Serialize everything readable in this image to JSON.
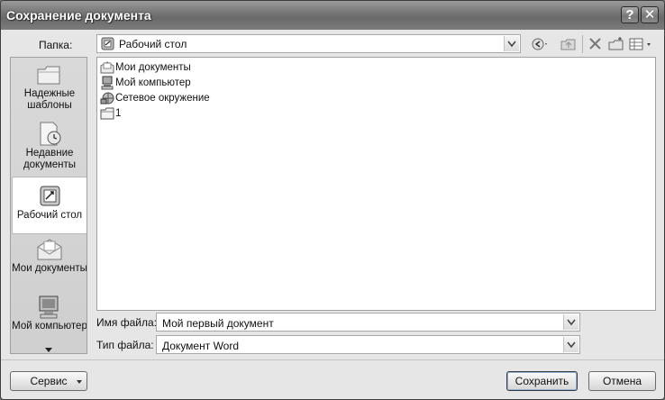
{
  "window": {
    "title": "Сохранение документа",
    "help_button": "?",
    "close_button": "✕"
  },
  "location": {
    "label": "Папка:",
    "value": "Рабочий стол"
  },
  "places": [
    {
      "label": "Надежные шаблоны",
      "icon": "folder-icon"
    },
    {
      "label": "Недавние документы",
      "icon": "recent-documents-icon"
    },
    {
      "label": "Рабочий стол",
      "icon": "desktop-icon",
      "selected": true
    },
    {
      "label": "Мои документы",
      "icon": "my-documents-icon"
    },
    {
      "label": "Мой компьютер",
      "icon": "my-computer-icon"
    }
  ],
  "files": [
    {
      "name": "Мои документы",
      "icon": "my-documents-icon"
    },
    {
      "name": "Мой компьютер",
      "icon": "my-computer-icon"
    },
    {
      "name": "Сетевое окружение",
      "icon": "network-icon"
    },
    {
      "name": "1",
      "icon": "folder-icon"
    }
  ],
  "filename": {
    "label": "Имя файла:",
    "value": "Мой первый документ"
  },
  "filetype": {
    "label": "Тип файла:",
    "value": "Документ Word"
  },
  "buttons": {
    "tools": "Сервис",
    "save": "Сохранить",
    "cancel": "Отмена"
  }
}
